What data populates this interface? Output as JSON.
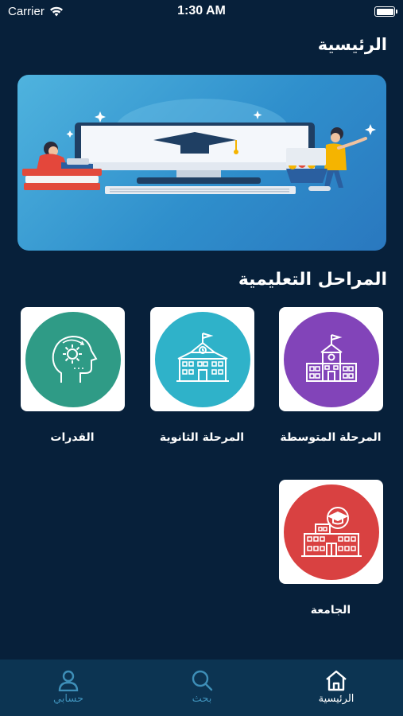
{
  "status_bar": {
    "carrier": "Carrier",
    "time": "1:30 AM",
    "battery_level": 1.0
  },
  "header": {
    "title": "الرئيسية"
  },
  "banner": {
    "image": "education-illustration"
  },
  "section": {
    "title": "المراحل التعليمية"
  },
  "stages": [
    {
      "label": "المرحلة المتوسطة",
      "icon": "school-building-icon",
      "color": "#8244b9"
    },
    {
      "label": "المرحلة الثانوية",
      "icon": "school-clock-building-icon",
      "color": "#2fb2c9"
    },
    {
      "label": "القدرات",
      "icon": "head-gear-icon",
      "color": "#2f9b86"
    },
    {
      "label": "الجامعة",
      "icon": "university-building-icon",
      "color": "#d94141"
    }
  ],
  "tab_bar": {
    "items": [
      {
        "label": "الرئيسية",
        "icon": "home-icon",
        "active": true
      },
      {
        "label": "بحث",
        "icon": "search-icon",
        "active": false
      },
      {
        "label": "حسابي",
        "icon": "user-icon",
        "active": false
      }
    ]
  },
  "colors": {
    "background": "#07203a",
    "tab_bar": "#0c3452",
    "inactive_tab": "#3e8fb8"
  }
}
